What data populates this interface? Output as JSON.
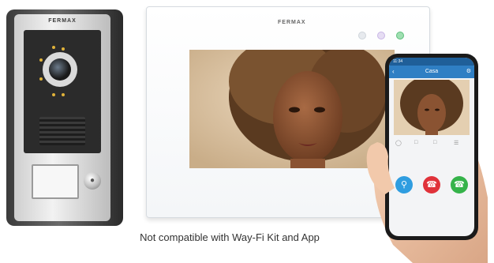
{
  "brand": "FERMAX",
  "caption": "Not compatible with Way-Fi Kit and App",
  "phone": {
    "time": "11:34",
    "title": "Casa"
  },
  "colors": {
    "key_button": "#2f9de0",
    "hangup_button": "#e0323a",
    "answer_button": "#35b34a",
    "app_bar": "#2f7fc4"
  }
}
